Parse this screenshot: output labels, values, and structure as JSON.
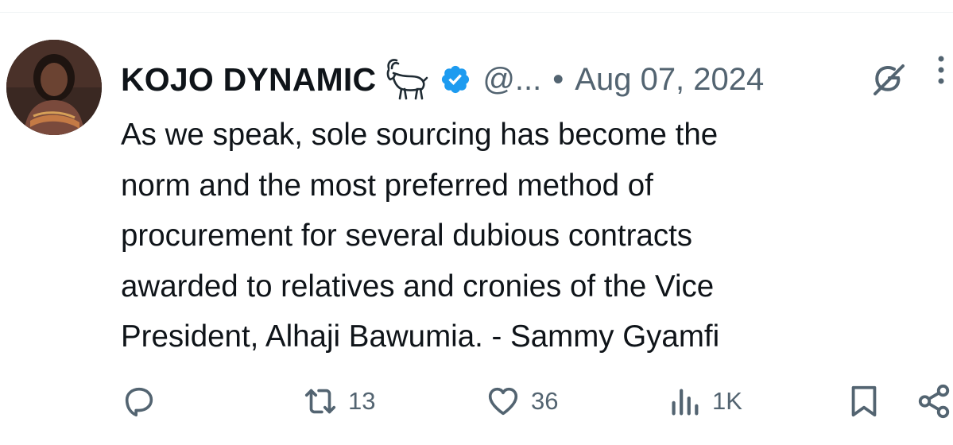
{
  "tweet": {
    "author": {
      "display_name": "KOJO DYNAMIC",
      "name_emoji": "goat-icon",
      "verified": true,
      "handle": "@...",
      "separator": "•"
    },
    "timestamp": "Aug 07, 2024",
    "text": "As we speak, sole sourcing has become the\nnorm and the most preferred method of\nprocurement for several dubious contracts\nawarded to relatives and cronies of the Vice\nPresident, Alhaji Bawumia. - Sammy Gyamfi",
    "actions": {
      "reply_count": "",
      "retweet_count": "13",
      "like_count": "36",
      "views_count": "1K"
    }
  },
  "colors": {
    "text_primary": "#0f1419",
    "text_secondary": "#536471",
    "verified_blue": "#1d9bf0",
    "divider": "#eff3f4"
  }
}
